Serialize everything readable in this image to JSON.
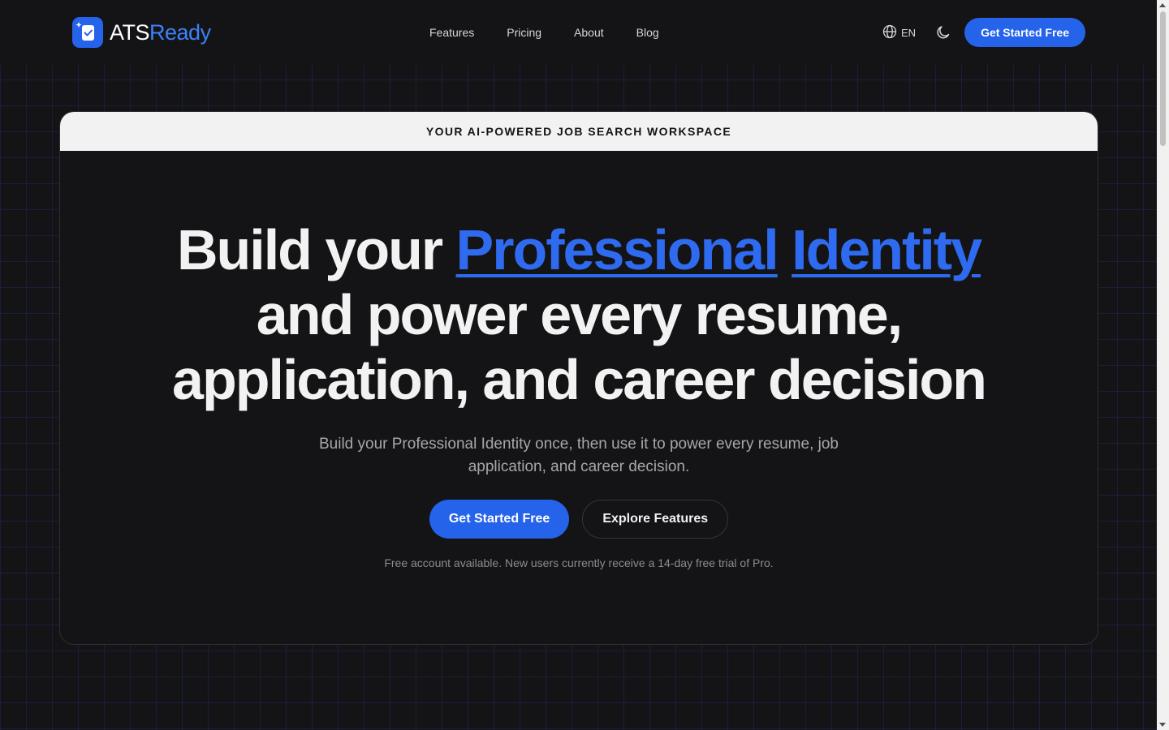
{
  "nav": {
    "logo_text_primary": "ATS",
    "logo_text_accent": "Ready",
    "links": [
      "Features",
      "Pricing",
      "About",
      "Blog"
    ],
    "language": "EN",
    "cta_label": "Get Started Free"
  },
  "hero": {
    "banner": "YOUR AI-POWERED JOB SEARCH WORKSPACE",
    "title_prefix": "Build your",
    "title_highlight_1": "Professional",
    "title_highlight_2": "Identity",
    "title_line_2": "and power every resume,",
    "title_line_3": "application, and career decision",
    "subtitle": "Build your Professional Identity once, then use it to power every resume, job application, and career decision.",
    "primary_cta": "Get Started Free",
    "secondary_cta": "Explore Features",
    "note": "Free account available. New users currently receive a 14-day free trial of Pro."
  },
  "colors": {
    "background": "#141417",
    "accent": "#2563eb",
    "banner_bg": "#f2f2f2"
  },
  "icons": [
    "logo-icon",
    "globe-icon",
    "moon-icon"
  ]
}
